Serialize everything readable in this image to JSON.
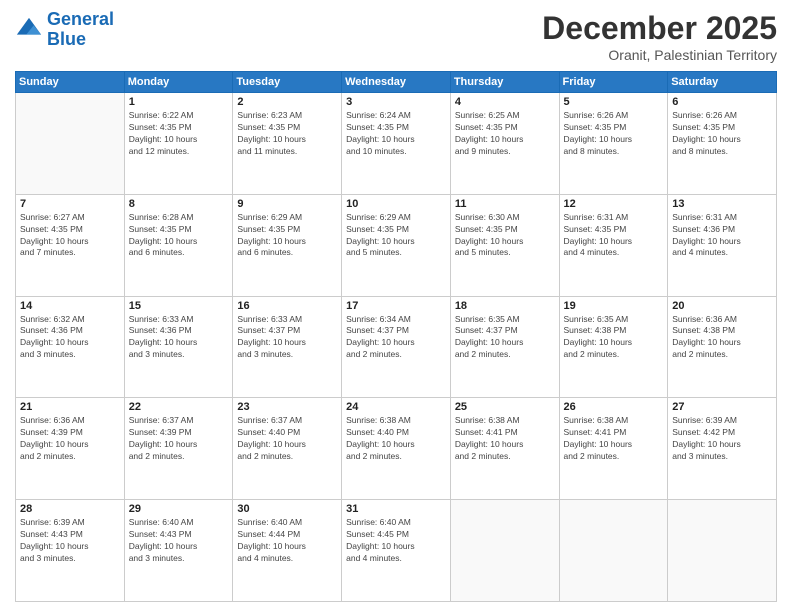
{
  "logo": {
    "line1": "General",
    "line2": "Blue"
  },
  "title": "December 2025",
  "subtitle": "Oranit, Palestinian Territory",
  "days_header": [
    "Sunday",
    "Monday",
    "Tuesday",
    "Wednesday",
    "Thursday",
    "Friday",
    "Saturday"
  ],
  "weeks": [
    [
      {
        "day": "",
        "info": ""
      },
      {
        "day": "1",
        "info": "Sunrise: 6:22 AM\nSunset: 4:35 PM\nDaylight: 10 hours\nand 12 minutes."
      },
      {
        "day": "2",
        "info": "Sunrise: 6:23 AM\nSunset: 4:35 PM\nDaylight: 10 hours\nand 11 minutes."
      },
      {
        "day": "3",
        "info": "Sunrise: 6:24 AM\nSunset: 4:35 PM\nDaylight: 10 hours\nand 10 minutes."
      },
      {
        "day": "4",
        "info": "Sunrise: 6:25 AM\nSunset: 4:35 PM\nDaylight: 10 hours\nand 9 minutes."
      },
      {
        "day": "5",
        "info": "Sunrise: 6:26 AM\nSunset: 4:35 PM\nDaylight: 10 hours\nand 8 minutes."
      },
      {
        "day": "6",
        "info": "Sunrise: 6:26 AM\nSunset: 4:35 PM\nDaylight: 10 hours\nand 8 minutes."
      }
    ],
    [
      {
        "day": "7",
        "info": "Sunrise: 6:27 AM\nSunset: 4:35 PM\nDaylight: 10 hours\nand 7 minutes."
      },
      {
        "day": "8",
        "info": "Sunrise: 6:28 AM\nSunset: 4:35 PM\nDaylight: 10 hours\nand 6 minutes."
      },
      {
        "day": "9",
        "info": "Sunrise: 6:29 AM\nSunset: 4:35 PM\nDaylight: 10 hours\nand 6 minutes."
      },
      {
        "day": "10",
        "info": "Sunrise: 6:29 AM\nSunset: 4:35 PM\nDaylight: 10 hours\nand 5 minutes."
      },
      {
        "day": "11",
        "info": "Sunrise: 6:30 AM\nSunset: 4:35 PM\nDaylight: 10 hours\nand 5 minutes."
      },
      {
        "day": "12",
        "info": "Sunrise: 6:31 AM\nSunset: 4:35 PM\nDaylight: 10 hours\nand 4 minutes."
      },
      {
        "day": "13",
        "info": "Sunrise: 6:31 AM\nSunset: 4:36 PM\nDaylight: 10 hours\nand 4 minutes."
      }
    ],
    [
      {
        "day": "14",
        "info": "Sunrise: 6:32 AM\nSunset: 4:36 PM\nDaylight: 10 hours\nand 3 minutes."
      },
      {
        "day": "15",
        "info": "Sunrise: 6:33 AM\nSunset: 4:36 PM\nDaylight: 10 hours\nand 3 minutes."
      },
      {
        "day": "16",
        "info": "Sunrise: 6:33 AM\nSunset: 4:37 PM\nDaylight: 10 hours\nand 3 minutes."
      },
      {
        "day": "17",
        "info": "Sunrise: 6:34 AM\nSunset: 4:37 PM\nDaylight: 10 hours\nand 2 minutes."
      },
      {
        "day": "18",
        "info": "Sunrise: 6:35 AM\nSunset: 4:37 PM\nDaylight: 10 hours\nand 2 minutes."
      },
      {
        "day": "19",
        "info": "Sunrise: 6:35 AM\nSunset: 4:38 PM\nDaylight: 10 hours\nand 2 minutes."
      },
      {
        "day": "20",
        "info": "Sunrise: 6:36 AM\nSunset: 4:38 PM\nDaylight: 10 hours\nand 2 minutes."
      }
    ],
    [
      {
        "day": "21",
        "info": "Sunrise: 6:36 AM\nSunset: 4:39 PM\nDaylight: 10 hours\nand 2 minutes."
      },
      {
        "day": "22",
        "info": "Sunrise: 6:37 AM\nSunset: 4:39 PM\nDaylight: 10 hours\nand 2 minutes."
      },
      {
        "day": "23",
        "info": "Sunrise: 6:37 AM\nSunset: 4:40 PM\nDaylight: 10 hours\nand 2 minutes."
      },
      {
        "day": "24",
        "info": "Sunrise: 6:38 AM\nSunset: 4:40 PM\nDaylight: 10 hours\nand 2 minutes."
      },
      {
        "day": "25",
        "info": "Sunrise: 6:38 AM\nSunset: 4:41 PM\nDaylight: 10 hours\nand 2 minutes."
      },
      {
        "day": "26",
        "info": "Sunrise: 6:38 AM\nSunset: 4:41 PM\nDaylight: 10 hours\nand 2 minutes."
      },
      {
        "day": "27",
        "info": "Sunrise: 6:39 AM\nSunset: 4:42 PM\nDaylight: 10 hours\nand 3 minutes."
      }
    ],
    [
      {
        "day": "28",
        "info": "Sunrise: 6:39 AM\nSunset: 4:43 PM\nDaylight: 10 hours\nand 3 minutes."
      },
      {
        "day": "29",
        "info": "Sunrise: 6:40 AM\nSunset: 4:43 PM\nDaylight: 10 hours\nand 3 minutes."
      },
      {
        "day": "30",
        "info": "Sunrise: 6:40 AM\nSunset: 4:44 PM\nDaylight: 10 hours\nand 4 minutes."
      },
      {
        "day": "31",
        "info": "Sunrise: 6:40 AM\nSunset: 4:45 PM\nDaylight: 10 hours\nand 4 minutes."
      },
      {
        "day": "",
        "info": ""
      },
      {
        "day": "",
        "info": ""
      },
      {
        "day": "",
        "info": ""
      }
    ]
  ]
}
